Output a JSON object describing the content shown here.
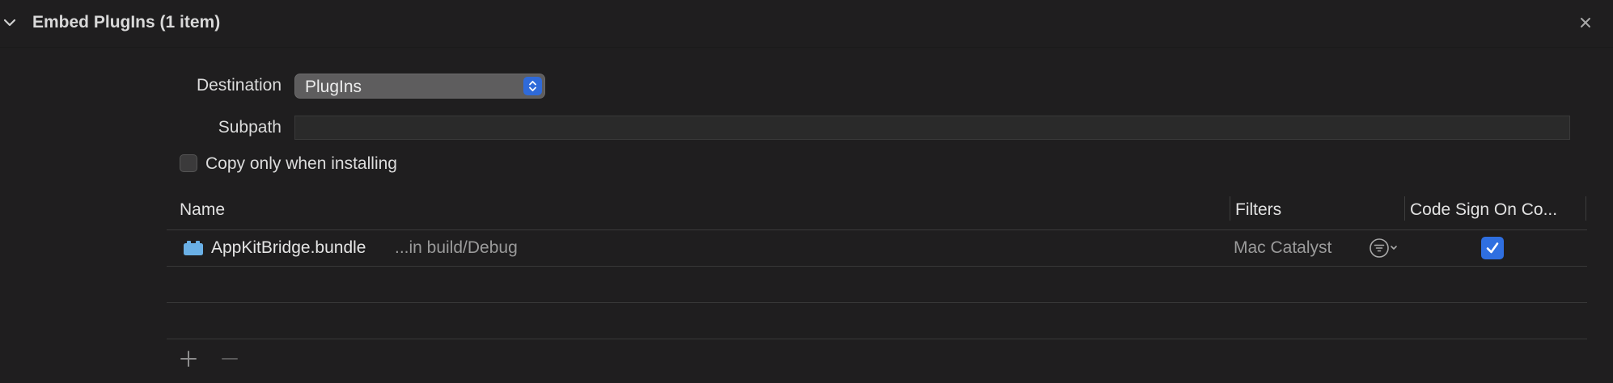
{
  "section": {
    "title": "Embed PlugIns (1 item)"
  },
  "form": {
    "destination_label": "Destination",
    "destination_value": "PlugIns",
    "subpath_label": "Subpath",
    "subpath_value": "",
    "copy_checkbox_label": "Copy only when installing",
    "copy_checked": false
  },
  "table": {
    "columns": [
      "Name",
      "Filters",
      "Code Sign On Co..."
    ],
    "rows": [
      {
        "name": "AppKitBridge.bundle",
        "location": "...in build/Debug",
        "filter": "Mac Catalyst",
        "code_sign": true
      }
    ]
  },
  "colors": {
    "accent": "#2f6fe0",
    "bundle_icon": "#6ab0e6",
    "background": "#1f1e1f"
  },
  "icons": [
    "chevron-down-icon",
    "close-icon",
    "select-stepper-icon",
    "bundle-icon",
    "filter-icon",
    "checkmark-icon",
    "plus-icon",
    "minus-icon"
  ]
}
